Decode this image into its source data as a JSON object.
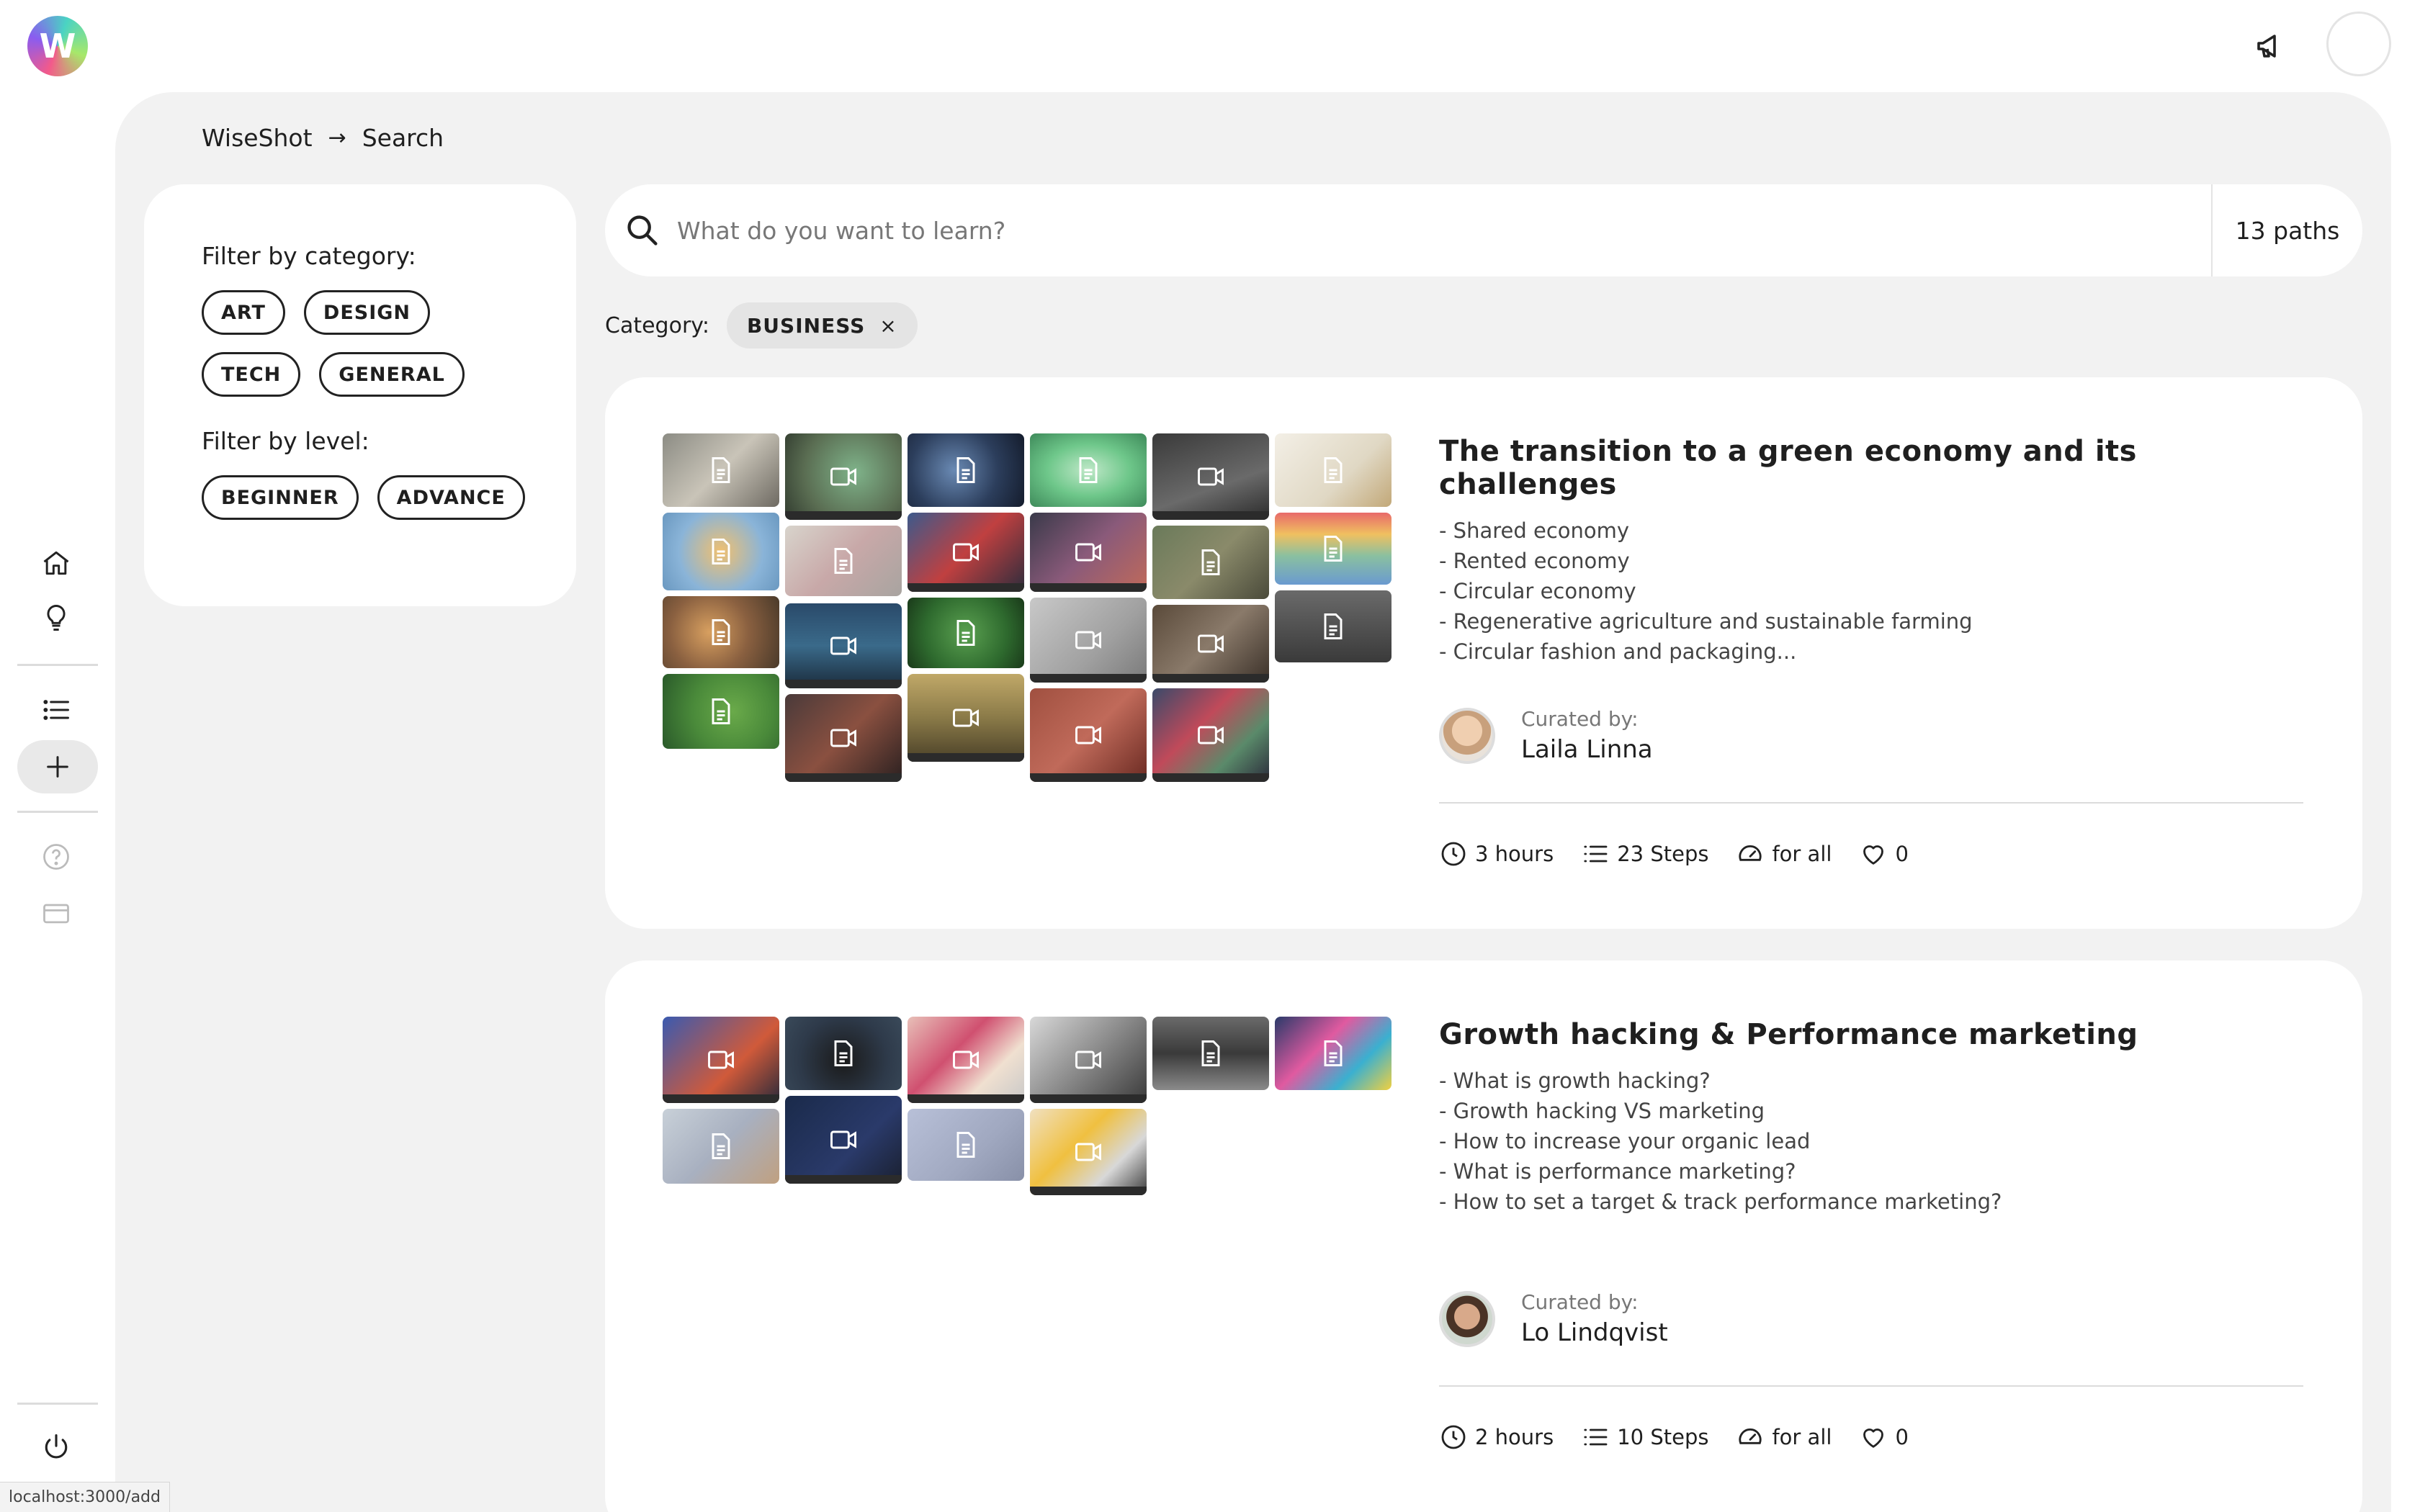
{
  "app": {
    "logo_letter": "W"
  },
  "breadcrumb": {
    "root": "WiseShot",
    "current": "Search"
  },
  "filters": {
    "category_title": "Filter by category:",
    "categories": [
      "ART",
      "DESIGN",
      "TECH",
      "GENERAL"
    ],
    "level_title": "Filter by level:",
    "levels": [
      "BEGINNER",
      "ADVANCE"
    ]
  },
  "search": {
    "placeholder": "What do you want to learn?",
    "count": "13 paths"
  },
  "active_category": {
    "label": "Category:",
    "value": "BUSINESS",
    "remove": "×"
  },
  "paths": [
    {
      "title": "The transition to a green economy and its challenges",
      "topics": [
        "- Shared economy",
        "- Rented economy",
        "- Circular economy",
        "- Regenerative agriculture and sustainable farming",
        "- Circular fashion and packaging..."
      ],
      "curated_label": "Curated by:",
      "curator": "Laila Linna",
      "duration": "3 hours",
      "steps": "23 Steps",
      "level": "for all",
      "likes": "0"
    },
    {
      "title": "Growth hacking & Performance marketing",
      "topics": [
        "- What is growth hacking?",
        "- Growth hacking VS marketing",
        "- How to increase your organic lead",
        "- What is performance marketing?",
        "- How to set a target & track performance marketing?"
      ],
      "curated_label": "Curated by:",
      "curator": "Lo Lindqvist",
      "duration": "2 hours",
      "steps": "10 Steps",
      "level": "for all",
      "likes": "0"
    }
  ],
  "status_bar": {
    "url": "localhost:3000/add"
  },
  "colors": {
    "accent_arrow": "#9b3fe0",
    "main_bg": "#f2f2f2",
    "card_bg": "#ffffff"
  }
}
